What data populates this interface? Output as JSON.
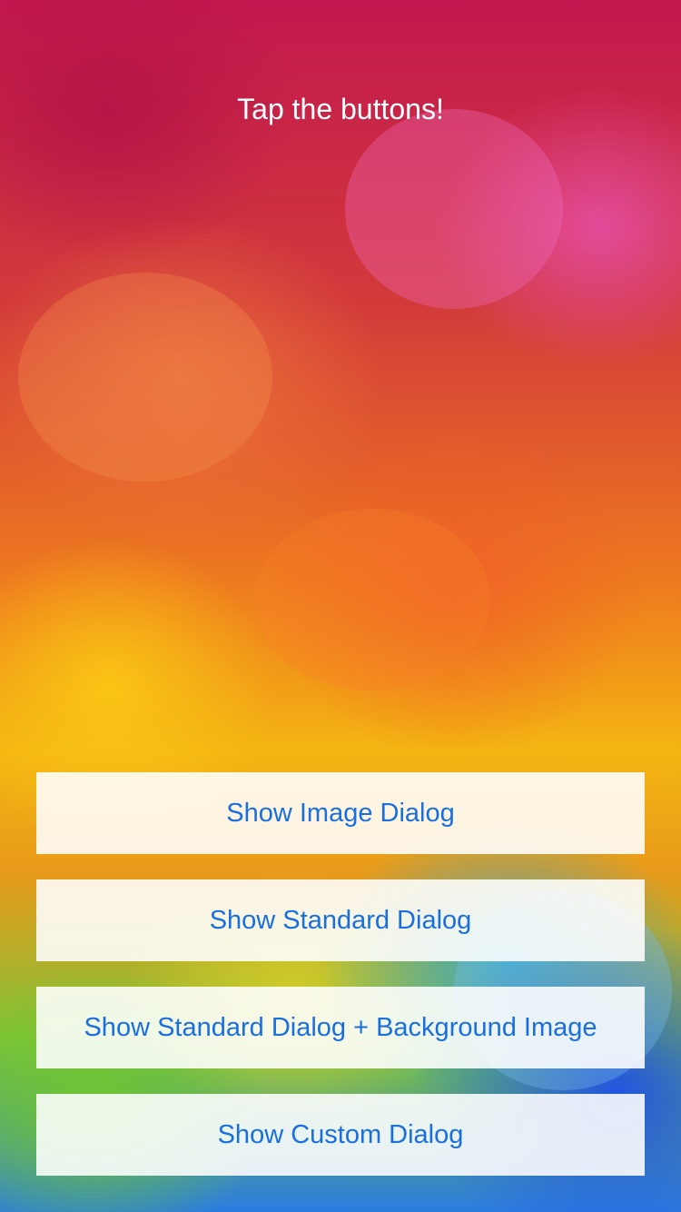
{
  "screen": {
    "title": "Tap the buttons!"
  },
  "buttons": [
    {
      "label": "Show Image Dialog"
    },
    {
      "label": "Show Standard Dialog"
    },
    {
      "label": "Show Standard Dialog + Background Image"
    },
    {
      "label": "Show Custom Dialog"
    }
  ],
  "colors": {
    "button_text": "#1a6fe0",
    "button_background": "#ffffff",
    "title_text": "#ffffff"
  }
}
